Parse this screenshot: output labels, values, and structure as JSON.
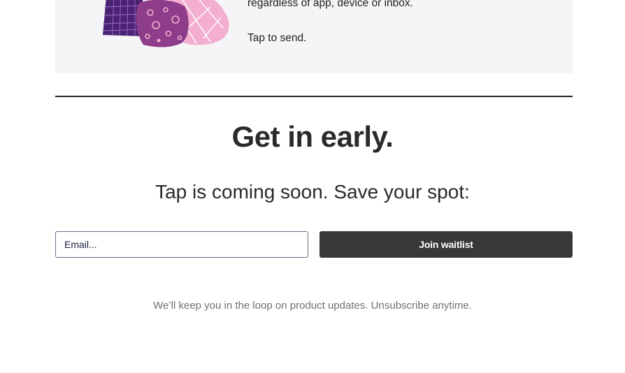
{
  "feature": {
    "line1": "regardless of app, device or inbox.",
    "line2": "Tap to send."
  },
  "waitlist": {
    "headline": "Get in early.",
    "subhead": "Tap is coming soon. Save your spot:",
    "email_placeholder": "Email...",
    "email_value": "",
    "join_label": "Join waitlist",
    "disclaimer": "We’ll keep you in the loop on product updates. Unsubscribe anytime."
  },
  "colors": {
    "card_background": "#f5f4f7",
    "button_background": "#383838",
    "illustration_dark_purple": "#4a2375",
    "illustration_magenta": "#8e3d8a",
    "illustration_pink": "#f3aed0"
  }
}
